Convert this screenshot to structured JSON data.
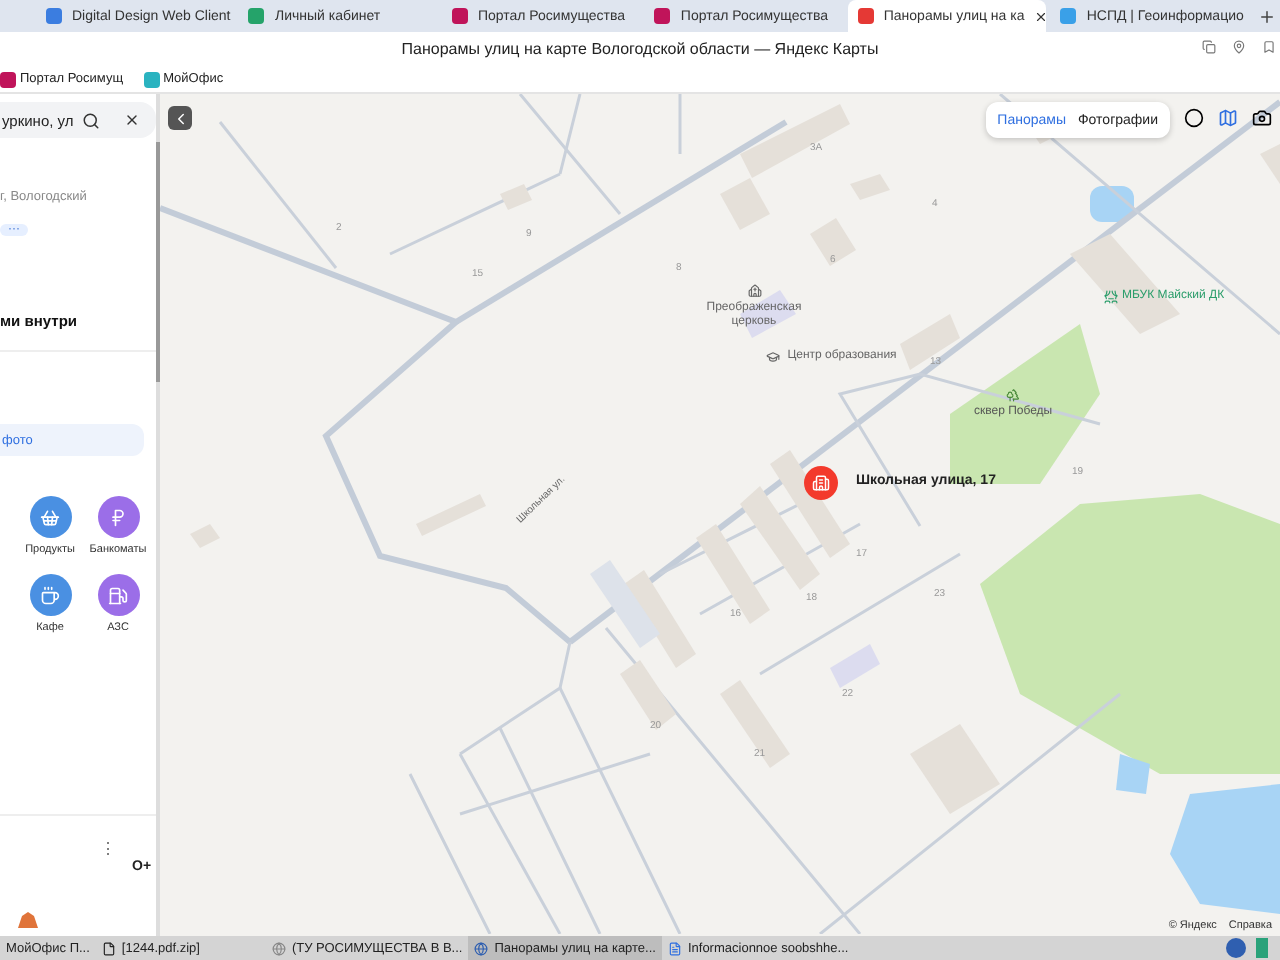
{
  "browser_tabs": [
    {
      "title": "Digital Design Web Client",
      "selected": false
    },
    {
      "title": "Личный кабинет",
      "selected": false
    },
    {
      "title": "Портал Росимущества",
      "selected": false
    },
    {
      "title": "Портал Росимущества",
      "selected": false
    },
    {
      "title": "Панорамы улиц на ка",
      "selected": true
    },
    {
      "title": "НСПД | Геоинформацио",
      "selected": false
    }
  ],
  "window": {
    "title": "Панорамы улиц на карте Вологодской области — Яндекс Карты"
  },
  "bookmarks": [
    "Портал Росимущ",
    "МойОфис"
  ],
  "sidebar": {
    "search": {
      "value": "уркино, ул"
    },
    "address": "г, Вологодский",
    "tag": "···",
    "heading": "ми внутри",
    "photo_button": "фото",
    "categories": [
      {
        "label": "Продукты",
        "color": "#4a90e2"
      },
      {
        "label": "Банкоматы",
        "color": "#9b6ee8"
      },
      {
        "label": "Кафе",
        "color": "#4a90e2"
      },
      {
        "label": "АЗС",
        "color": "#9b6ee8"
      }
    ],
    "more": "⋮",
    "footer_label": "O+"
  },
  "map": {
    "modes": [
      {
        "label": "Панорамы",
        "selected": true
      },
      {
        "label": "Фотографии",
        "selected": false
      }
    ],
    "street": "Школьная ул.",
    "houses": [
      "3А",
      "4",
      "6",
      "13",
      "19",
      "17",
      "18",
      "16",
      "20",
      "21",
      "22",
      "23",
      "2",
      "8",
      "9",
      "15"
    ],
    "pois": [
      {
        "label": "Преображенская церковь",
        "kind": "church"
      },
      {
        "label": "Центр образования",
        "kind": "school"
      },
      {
        "label": "МБУК Майский ДК",
        "kind": "culture"
      },
      {
        "label": "сквер Победы",
        "kind": "park"
      }
    ],
    "pin": {
      "label": "Школьная улица, 17"
    },
    "copyright": "© Яндекс",
    "help_link": "Справка"
  },
  "taskbar": [
    {
      "title": "МойОфис П...",
      "selected": false
    },
    {
      "title": "[1244.pdf.zip]",
      "selected": false
    },
    {
      "title": "(ТУ РОСИМУЩЕСТВА В В...",
      "selected": false
    },
    {
      "title": "Панорамы улиц на карте...",
      "selected": true
    },
    {
      "title": "Informacionnoe soobshhe...",
      "selected": false
    }
  ]
}
